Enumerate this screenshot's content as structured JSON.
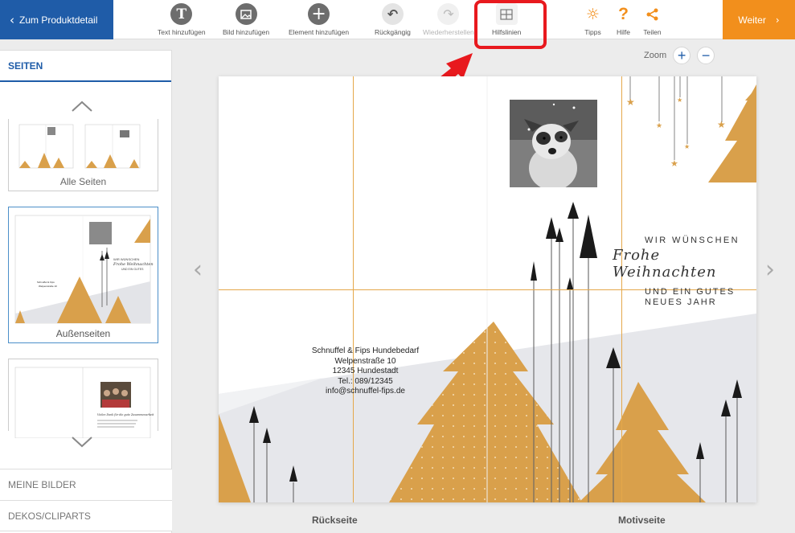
{
  "toolbar": {
    "back_label": "Zum Produktdetail",
    "tools": {
      "text": "Text hinzufügen",
      "image": "Bild hinzufügen",
      "element": "Element hinzufügen",
      "undo": "Rückgängig",
      "redo": "Wiederherstellen",
      "guides": "Hilfslinien",
      "tips": "Tipps",
      "help": "Hilfe",
      "share": "Teilen"
    },
    "next_label": "Weiter"
  },
  "sidebar": {
    "title": "SEITEN",
    "thumbnails": [
      {
        "label": "Alle Seiten"
      },
      {
        "label": "Außenseiten"
      },
      {
        "label": ""
      }
    ],
    "sections": [
      "MEINE BILDER",
      "DEKOS/CLIPARTS"
    ]
  },
  "zoom": {
    "label": "Zoom"
  },
  "card": {
    "greeting_line1": "WIR WÜNSCHEN",
    "greeting_line2": "Frohe Weihnachten",
    "greeting_line3": "UND EIN GUTES",
    "greeting_line4": "NEUES JAHR",
    "address": {
      "company": "Schnuffel & Fips Hundebedarf",
      "street": "Welpenstraße 10",
      "city": "12345 Hundestadt",
      "phone": "Tel.: 089/12345",
      "email": "info@schnuffel-fips.de"
    }
  },
  "pages": {
    "back": "Rückseite",
    "front": "Motivseite"
  },
  "colors": {
    "brand_blue": "#1f5ca8",
    "accent_orange": "#f28f1c",
    "gold": "#d9a04b",
    "highlight_red": "#e8191e"
  }
}
